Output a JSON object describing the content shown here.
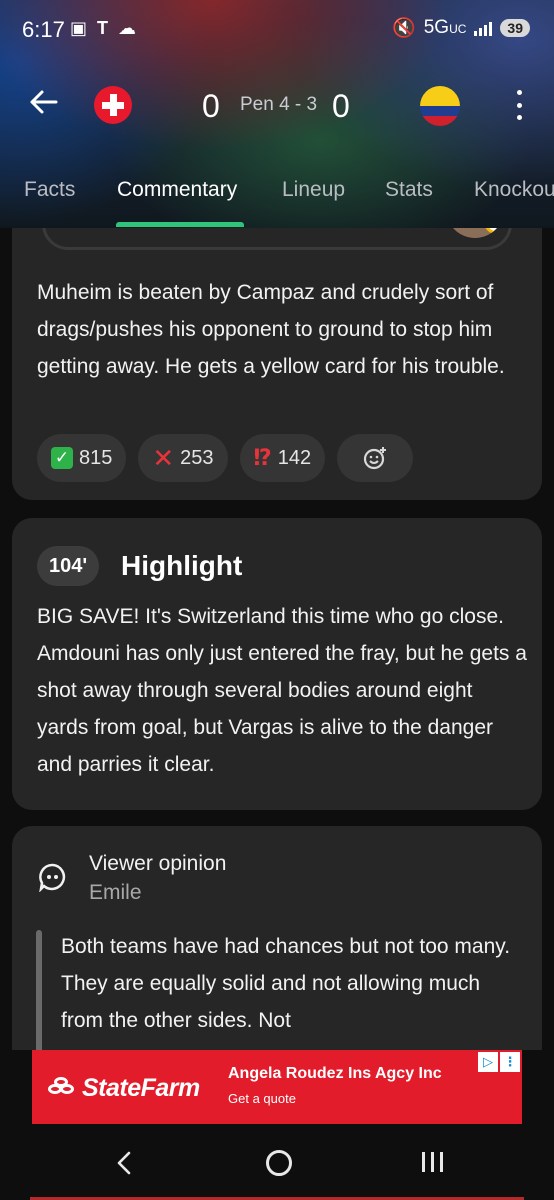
{
  "status_bar": {
    "time": "6:17",
    "network": "5G",
    "network_sub": "UC",
    "battery": "39"
  },
  "match": {
    "home_team_flag": "switzerland-flag",
    "away_team_flag": "colombia-flag",
    "home_score": "0",
    "away_score": "0",
    "penalties": "Pen 4 - 3"
  },
  "tabs": [
    {
      "label": "Facts",
      "active": false
    },
    {
      "label": "Commentary",
      "active": true
    },
    {
      "label": "Lineup",
      "active": false
    },
    {
      "label": "Stats",
      "active": false
    },
    {
      "label": "Knockout",
      "active": false
    }
  ],
  "commentary": [
    {
      "text": "Muheim is beaten by Campaz and crudely sort of drags/pushes his opponent to ground to stop him getting away. He gets a yellow card for his trouble.",
      "reactions": [
        {
          "emoji": "check",
          "count": "815"
        },
        {
          "emoji": "cross",
          "count": "253"
        },
        {
          "emoji": "interrobang",
          "count": "142"
        }
      ]
    },
    {
      "minute": "104'",
      "title": "Highlight",
      "text": "BIG SAVE! It's Switzerland this time who go close. Amdouni has only just entered the fray, but he gets a shot away through several bodies around eight yards from goal, but Vargas is alive to the danger and parries it clear."
    },
    {
      "label": "Viewer opinion",
      "author": "Emile",
      "text": "Both teams have had chances but not too many. They are equally solid and not allowing much from the other sides. Not"
    }
  ],
  "ad": {
    "brand": "StateFarm",
    "title": "Angela Roudez Ins Agcy Inc",
    "subtitle": "Get a quote"
  },
  "colors": {
    "accent": "#2fc47a",
    "card": "#262626",
    "ad_red": "#e21c2a"
  }
}
